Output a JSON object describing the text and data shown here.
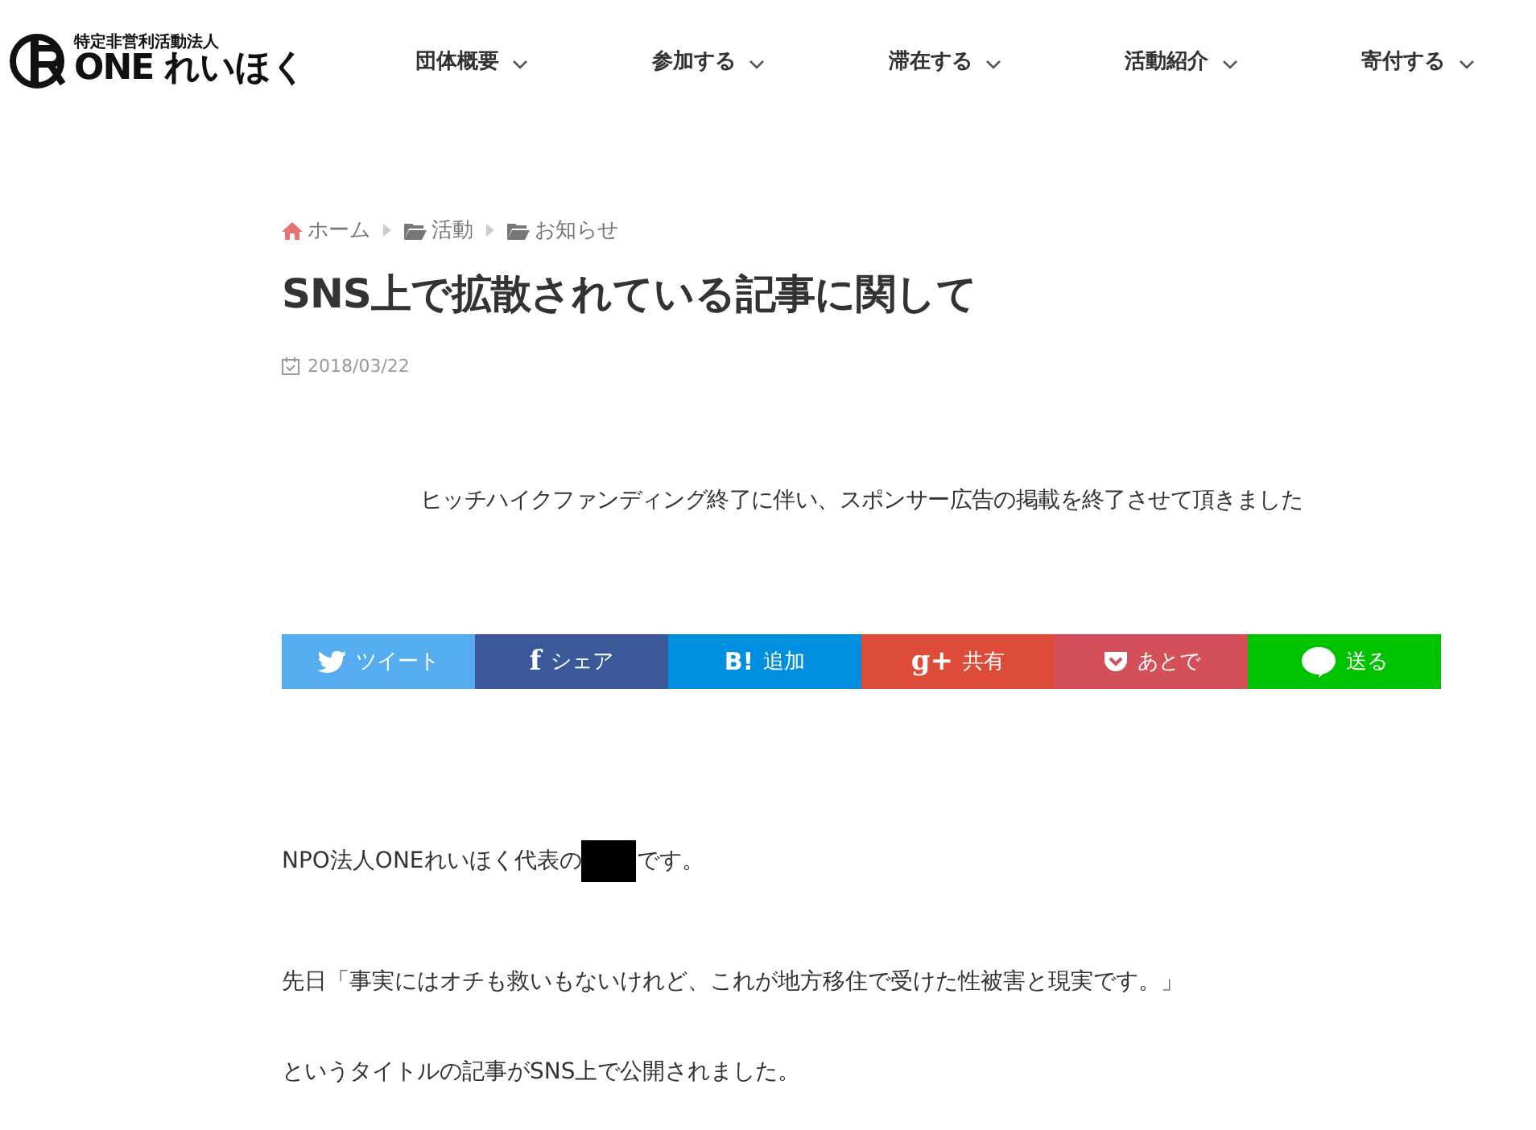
{
  "logo": {
    "subtitle": "特定非営利活動法人",
    "name": "ONE れいほく"
  },
  "nav": [
    {
      "label": "団体概要"
    },
    {
      "label": "参加する"
    },
    {
      "label": "滞在する"
    },
    {
      "label": "活動紹介"
    },
    {
      "label": "寄付する"
    }
  ],
  "breadcrumb": [
    {
      "label": "ホーム",
      "kind": "home"
    },
    {
      "label": "活動",
      "kind": "folder"
    },
    {
      "label": "お知らせ",
      "kind": "folder"
    }
  ],
  "article": {
    "title": "SNS上で拡散されている記事に関して",
    "date": "2018/03/22",
    "notice": "ヒッチハイクファンディング終了に伴い、スポンサー広告の掲載を終了させて頂きました"
  },
  "share": [
    {
      "kind": "twitter",
      "label": "ツイート",
      "color": "#55acee"
    },
    {
      "kind": "facebook",
      "glyph": "f",
      "label": "シェア",
      "color": "#3b5998"
    },
    {
      "kind": "hatena",
      "glyph": "B!",
      "label": "追加",
      "color": "#008fde"
    },
    {
      "kind": "google",
      "glyph": "g+",
      "label": "共有",
      "color": "#dd4b39"
    },
    {
      "kind": "pocket",
      "label": "あとで",
      "color": "#d3505a"
    },
    {
      "kind": "line",
      "label": "送る",
      "color": "#00c300"
    }
  ],
  "body": [
    {
      "kind": "redacted",
      "before": "NPO法人ONEれいほく代表の",
      "after": "です。"
    },
    {
      "kind": "text",
      "text": "先日「事実にはオチも救いもないけれど、これが地方移住で受けた性被害と現実です。」"
    },
    {
      "kind": "text",
      "text": "というタイトルの記事がSNS上で公開されました。"
    }
  ]
}
